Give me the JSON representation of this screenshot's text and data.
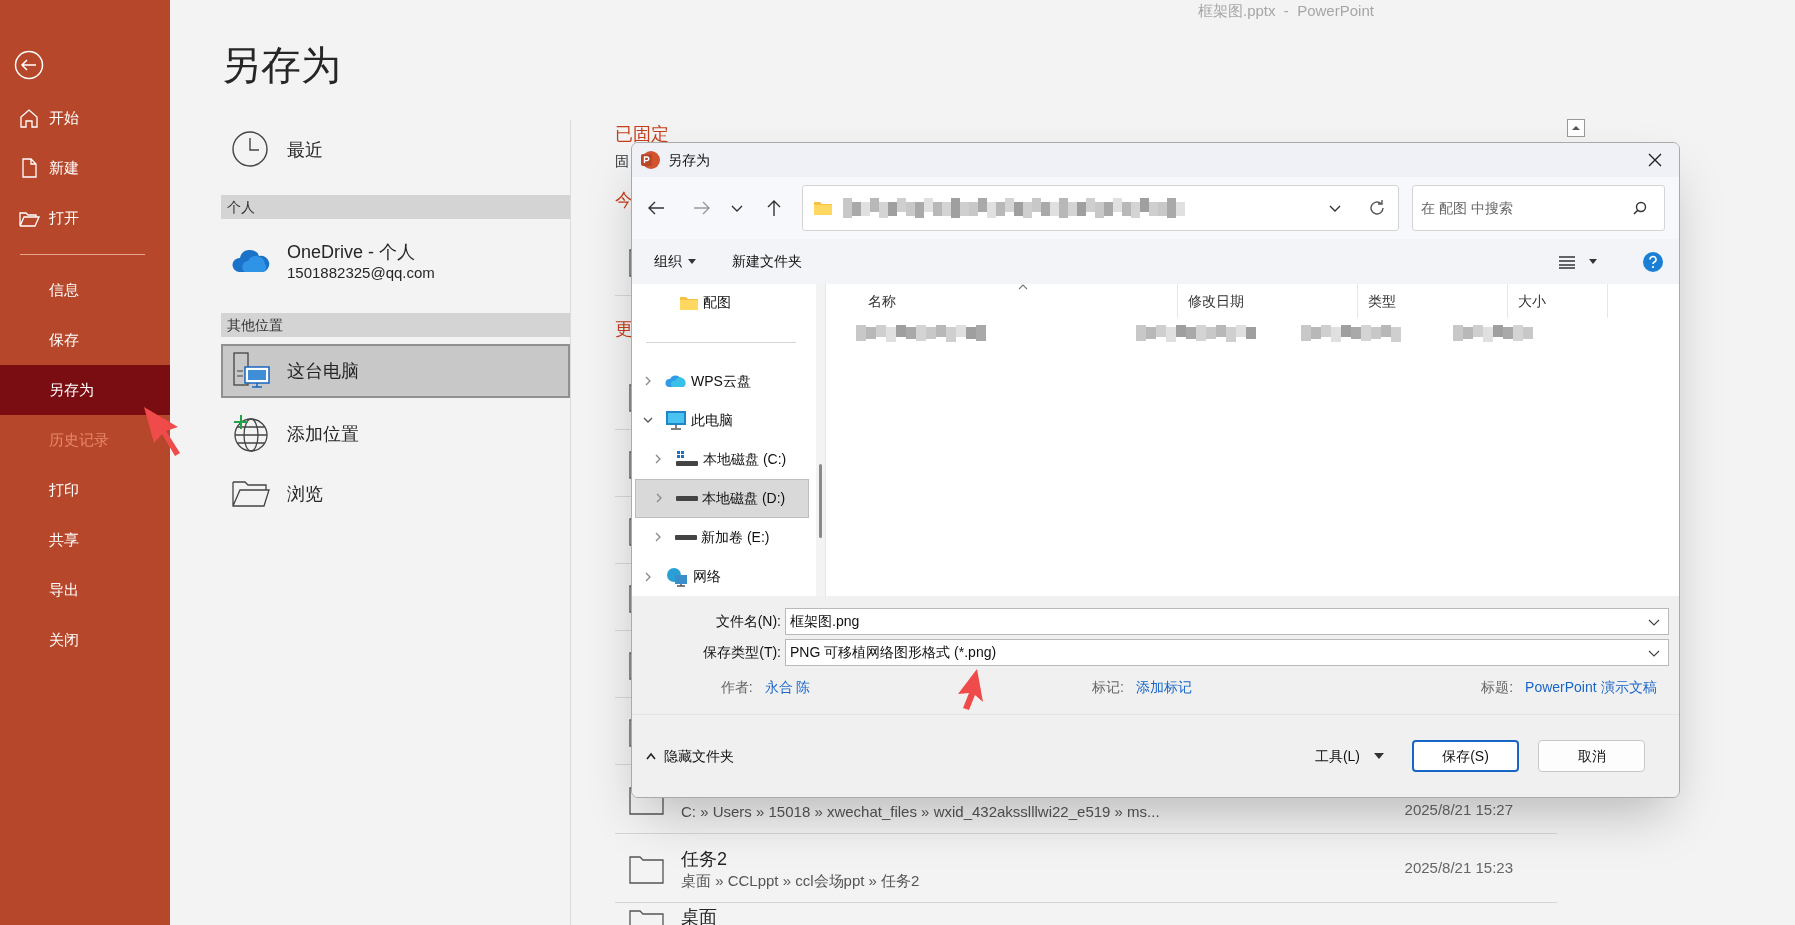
{
  "window": {
    "title": "框架图.pptx  -  PowerPoint"
  },
  "sidebar": {
    "items": [
      {
        "label": "开始",
        "kind": "home",
        "selected": false,
        "disabled": false
      },
      {
        "label": "新建",
        "kind": "new",
        "selected": false,
        "disabled": false
      },
      {
        "label": "打开",
        "kind": "open",
        "selected": false,
        "disabled": false
      },
      {
        "kind": "divider"
      },
      {
        "label": "信息",
        "kind": "plain",
        "selected": false,
        "disabled": false
      },
      {
        "label": "保存",
        "kind": "plain",
        "selected": false,
        "disabled": false
      },
      {
        "label": "另存为",
        "kind": "plain",
        "selected": true,
        "disabled": false
      },
      {
        "label": "历史记录",
        "kind": "plain",
        "selected": false,
        "disabled": true
      },
      {
        "label": "打印",
        "kind": "plain",
        "selected": false,
        "disabled": false
      },
      {
        "label": "共享",
        "kind": "plain",
        "selected": false,
        "disabled": false
      },
      {
        "label": "导出",
        "kind": "plain",
        "selected": false,
        "disabled": false
      },
      {
        "label": "关闭",
        "kind": "plain",
        "selected": false,
        "disabled": false
      }
    ]
  },
  "page_title": "另存为",
  "locations": [
    {
      "kind": "clock",
      "label": "最近",
      "selected": false
    },
    {
      "kind": "header",
      "label": "个人"
    },
    {
      "kind": "cloud",
      "label": "OneDrive - 个人",
      "sublabel": "1501882325@qq.com",
      "selected": false
    },
    {
      "kind": "header",
      "label": "其他位置"
    },
    {
      "kind": "pc",
      "label": "这台电脑",
      "selected": true
    },
    {
      "kind": "globe",
      "label": "添加位置",
      "selected": false
    },
    {
      "kind": "folder",
      "label": "浏览",
      "selected": false
    }
  ],
  "recent_panel": {
    "pinned_heading": "已固定",
    "pinned_note": "固",
    "today_heading": "今",
    "older_heading": "更",
    "rows": [
      {
        "path": "C: » Users » 15018 » xwechat_files » wxid_432aksslllwi22_e519 » ms...",
        "date": "2025/8/21 15:27"
      },
      {
        "name": "任务2",
        "path": "桌面 » CCLppt » ccl会场ppt » 任务2",
        "date": "2025/8/21 15:23"
      },
      {
        "name": "桌面"
      }
    ]
  },
  "dialog": {
    "title": "另存为",
    "search_placeholder": "在 配图 中搜索",
    "toolbar": {
      "organize": "组织",
      "new_folder": "新建文件夹"
    },
    "nav": [
      {
        "label": "配图",
        "kind": "folder",
        "selected": false
      },
      {
        "kind": "separator"
      },
      {
        "label": "WPS云盘",
        "kind": "cloud",
        "expanded": false,
        "selected": false
      },
      {
        "label": "此电脑",
        "kind": "pc",
        "expanded": true,
        "selected": false,
        "children": [
          {
            "label": "本地磁盘 (C:)",
            "kind": "system_drive",
            "expanded": false,
            "selected": false
          },
          {
            "label": "本地磁盘 (D:)",
            "kind": "drive",
            "expanded": false,
            "selected": true
          },
          {
            "label": "新加卷 (E:)",
            "kind": "drive",
            "expanded": false,
            "selected": false
          }
        ]
      },
      {
        "label": "网络",
        "kind": "network",
        "expanded": false,
        "selected": false
      }
    ],
    "columns": [
      {
        "label": "名称",
        "sorted": true
      },
      {
        "label": "修改日期",
        "sorted": false
      },
      {
        "label": "类型",
        "sorted": false
      },
      {
        "label": "大小",
        "sorted": false
      }
    ],
    "file_name": {
      "label": "文件名(N):",
      "value": "框架图.png"
    },
    "save_type": {
      "label": "保存类型(T):",
      "value": "PNG 可移植网络图形格式 (*.png)"
    },
    "meta": [
      {
        "label": "作者:",
        "value": "永合 陈"
      },
      {
        "label": "标记:",
        "value": "添加标记"
      },
      {
        "label": "标题:",
        "value": "PowerPoint 演示文稿"
      }
    ],
    "hide_folders": "隐藏文件夹",
    "tools": "工具(L)",
    "save": "保存(S)",
    "cancel": "取消"
  }
}
